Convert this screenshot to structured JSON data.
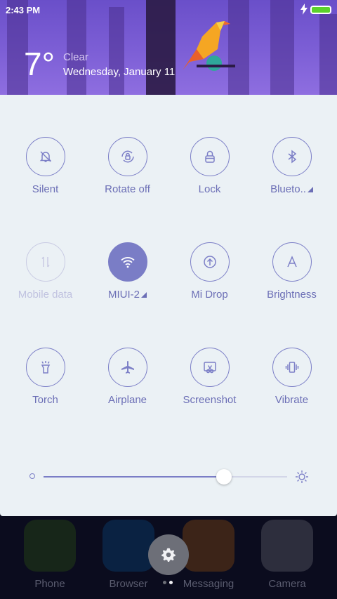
{
  "status_bar": {
    "time": "2:43 PM"
  },
  "weather": {
    "temperature": "7°",
    "condition": "Clear",
    "date": "Wednesday, January 11"
  },
  "toggles": [
    {
      "label": "Silent",
      "icon": "bell-off-icon"
    },
    {
      "label": "Rotate off",
      "icon": "rotate-lock-icon"
    },
    {
      "label": "Lock",
      "icon": "lock-icon"
    },
    {
      "label": "Blueto..",
      "icon": "bluetooth-icon"
    },
    {
      "label": "Mobile data",
      "icon": "mobile-data-icon"
    },
    {
      "label": "MIUI-2",
      "icon": "wifi-icon"
    },
    {
      "label": "Mi Drop",
      "icon": "mi-drop-icon"
    },
    {
      "label": "Brightness",
      "icon": "brightness-auto-icon"
    },
    {
      "label": "Torch",
      "icon": "torch-icon"
    },
    {
      "label": "Airplane",
      "icon": "airplane-icon"
    },
    {
      "label": "Screenshot",
      "icon": "screenshot-icon"
    },
    {
      "label": "Vibrate",
      "icon": "vibrate-icon"
    }
  ],
  "brightness": {
    "level": 0.74
  },
  "dock": {
    "apps": [
      {
        "label": "Phone",
        "color": "#3a6b10"
      },
      {
        "label": "Browser",
        "color": "#0a5fa0"
      },
      {
        "label": "Messaging",
        "color": "#c0640a"
      },
      {
        "label": "Camera",
        "color": "#8a8a90"
      }
    ]
  },
  "colors": {
    "accent": "#7a7dc6",
    "panel": "#ebf1f5",
    "header": "#7d5fd6"
  }
}
